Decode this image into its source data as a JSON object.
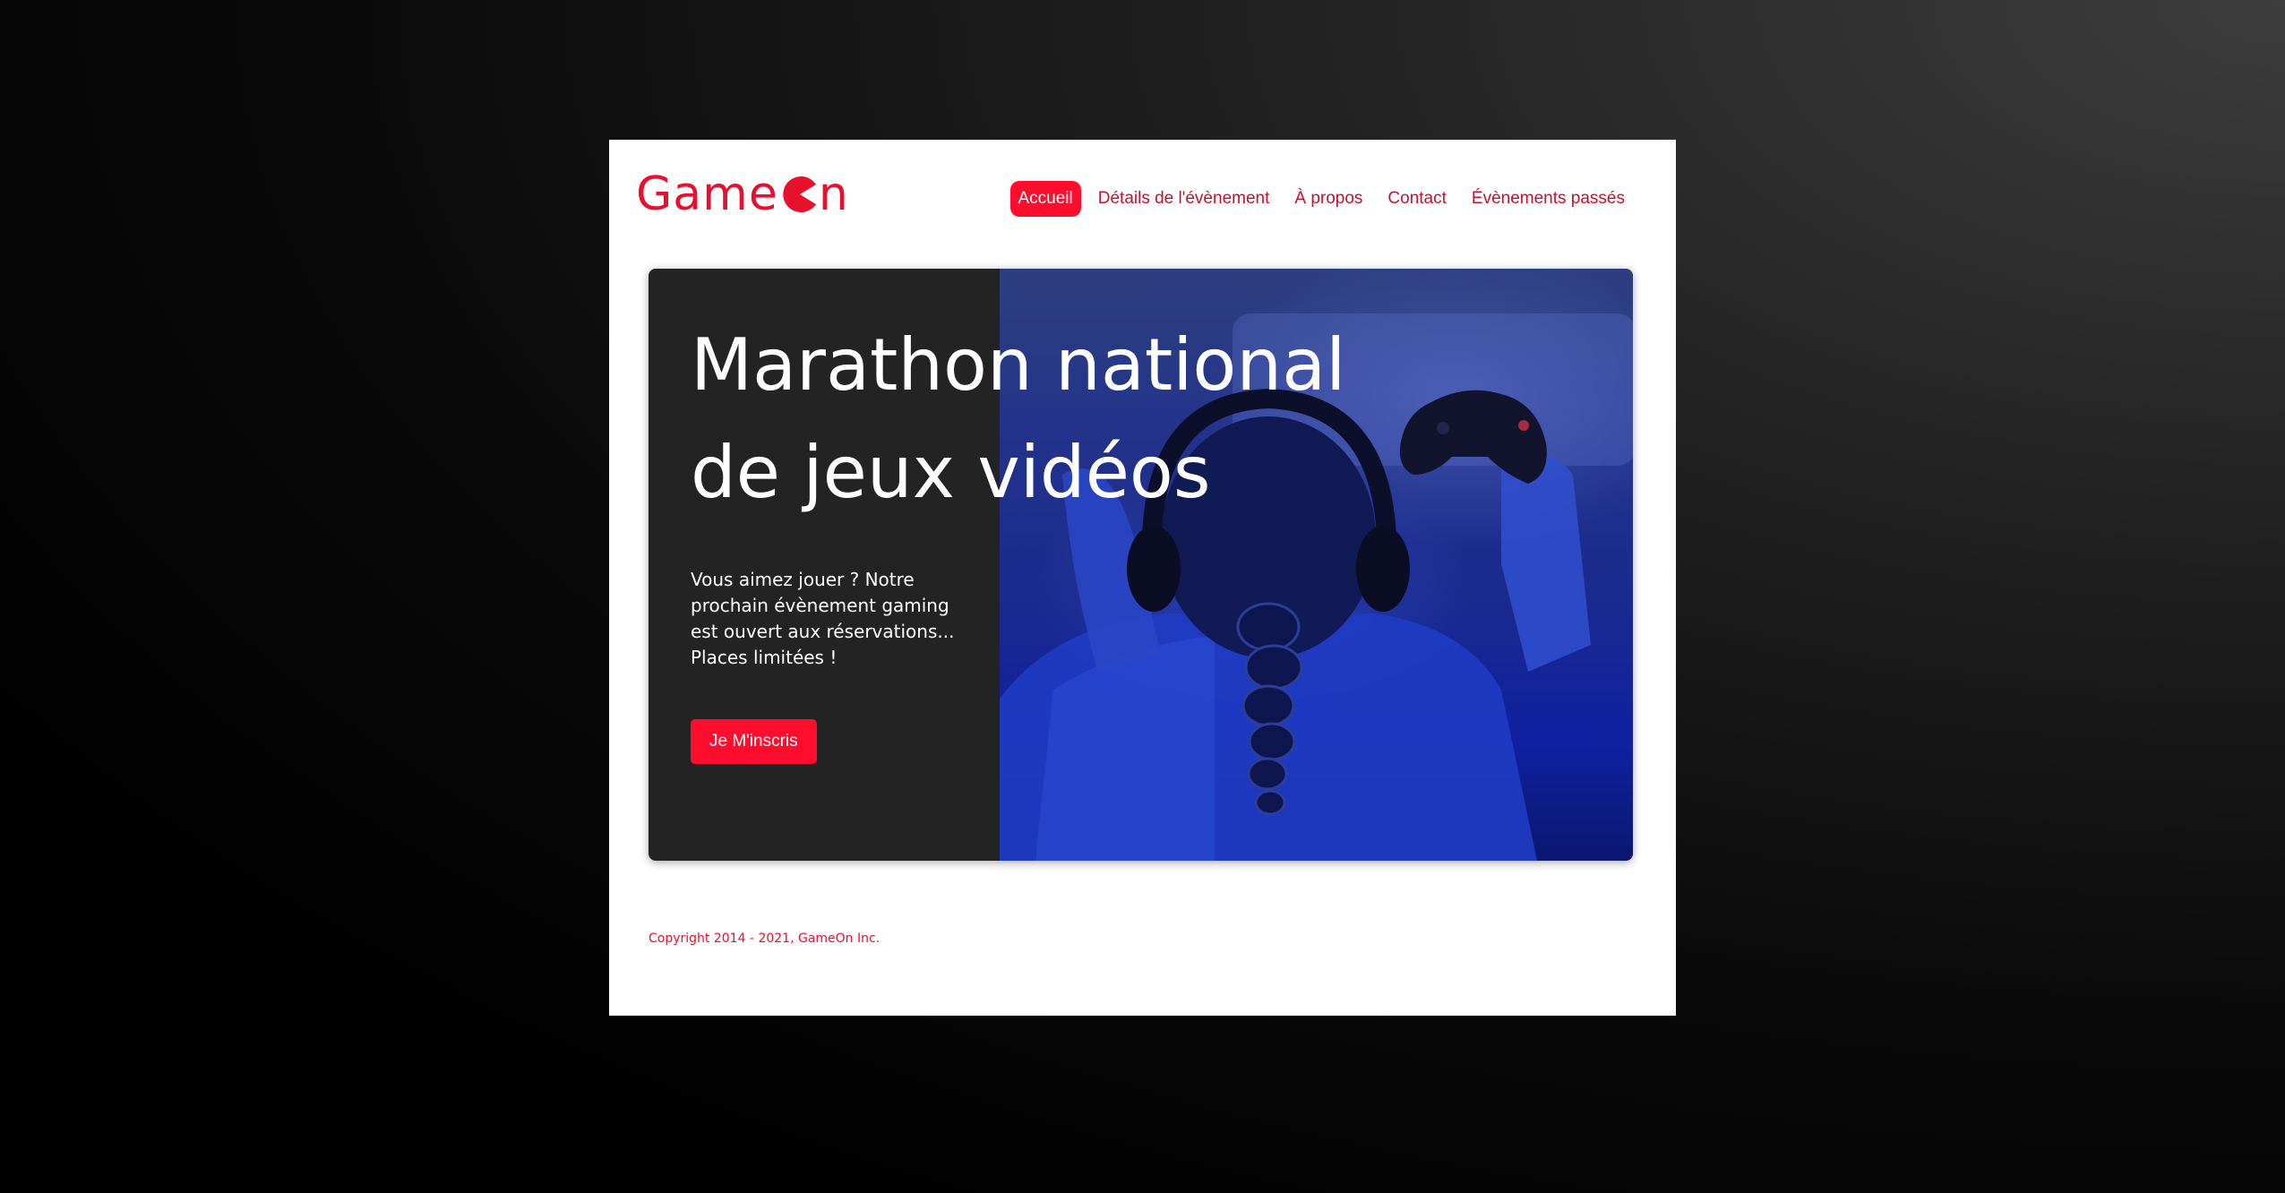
{
  "brand": {
    "name_start": "Game",
    "name_end": "n",
    "accent_color": "#fe0d2d",
    "logo_icon": "pacman-icon"
  },
  "nav": {
    "items": [
      {
        "label": "Accueil",
        "active": true
      },
      {
        "label": "Détails de l'évènement",
        "active": false
      },
      {
        "label": "À propos",
        "active": false
      },
      {
        "label": "Contact",
        "active": false
      },
      {
        "label": "Évènements passés",
        "active": false
      }
    ]
  },
  "hero": {
    "title_line1": "Marathon national",
    "title_line2": "de jeux vidéos",
    "description": "Vous aimez jouer ? Notre prochain évènement gaming est ouvert aux réservations... Places limitées !",
    "cta_label": "Je M'inscris",
    "image_subject": "gamer-with-headphones-and-controller"
  },
  "footer": {
    "copyright": "Copyright 2014 - 2021, GameOn Inc."
  }
}
